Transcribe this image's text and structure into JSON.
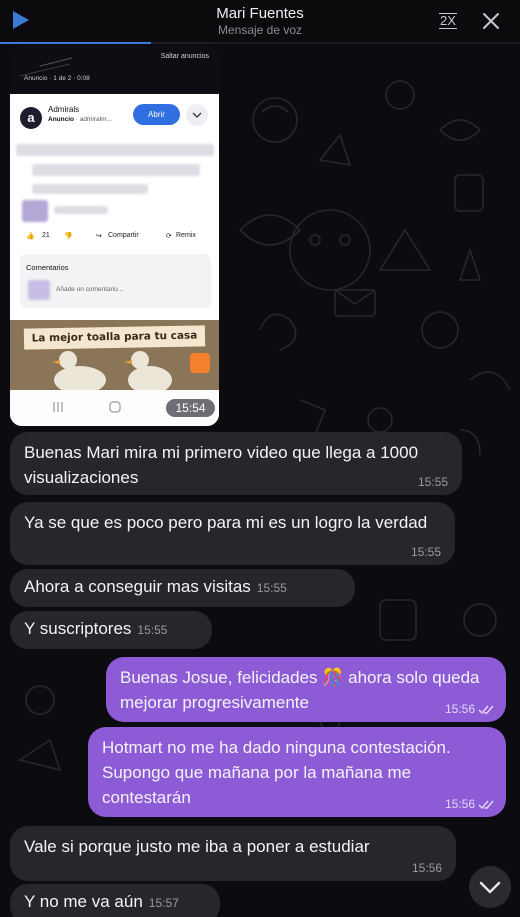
{
  "header": {
    "title": "Mari Fuentes",
    "subtitle": "Mensaje de voz",
    "speed": "2X",
    "progress_fraction": 0.29
  },
  "screenshot": {
    "skip_ads": "Saltar anuncios",
    "ad_info": "Anuncio · 1 de 2 · 0:08",
    "brand_initial": "a",
    "brand_name": "Admirals",
    "brand_tag": "Anuncio",
    "brand_handle": " · admiralm...",
    "open_button": "Abrir",
    "likes": "21",
    "share": "Compartir",
    "remix": "Remix",
    "comments_title": "Comentarios",
    "comment_placeholder": "Añade un comentario...",
    "banner_text": "La mejor toalla para tu casa",
    "time": "15:54"
  },
  "messages": [
    {
      "dir": "in",
      "text": "Buenas Mari mira mi primero video que llega a 1000 visualizaciones",
      "time": "15:55"
    },
    {
      "dir": "in",
      "text": "Ya se que es poco pero para mi es un logro la verdad",
      "time": "15:55"
    },
    {
      "dir": "in",
      "text": "Ahora a conseguir mas visitas",
      "time": "15:55"
    },
    {
      "dir": "in",
      "text": "Y suscriptores",
      "time": "15:55"
    },
    {
      "dir": "out",
      "text": "Buenas Josue, felicidades 🎊 ahora solo queda mejorar progresivamente",
      "time": "15:56"
    },
    {
      "dir": "out",
      "text": "Hotmart no me ha dado ninguna contestación. Supongo que mañana por la mañana me contestarán",
      "time": "15:56"
    },
    {
      "dir": "in",
      "text": "Vale si porque justo me iba a poner a estudiar",
      "time": "15:56"
    },
    {
      "dir": "in",
      "text": "Y no me va aún",
      "time": "15:57"
    }
  ],
  "colors": {
    "incoming_bubble": "#26262b",
    "outgoing_bubble": "#8e5bd6",
    "accent": "#3a7bd5"
  }
}
